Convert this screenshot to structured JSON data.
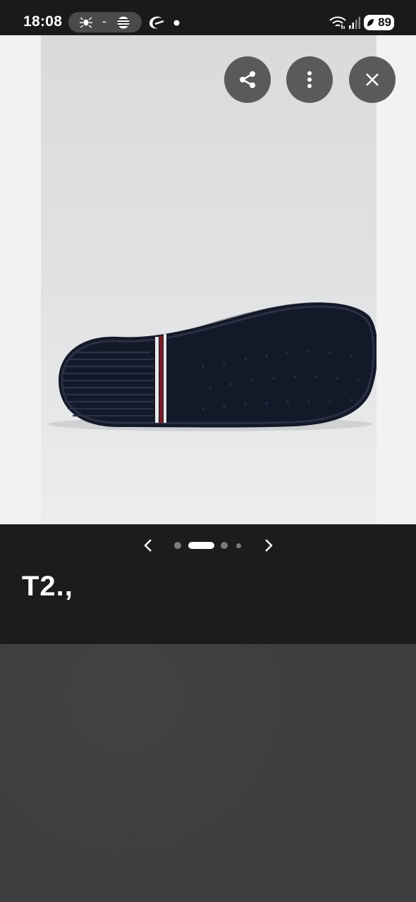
{
  "status_bar": {
    "time": "18:08",
    "battery": "89",
    "icons": [
      "spider-icon",
      "dash",
      "flag-icon",
      "crescent-icon",
      "dot-icon",
      "wifi-icon",
      "signal-icon",
      "battery-icon"
    ]
  },
  "viewer": {
    "buttons": [
      {
        "name": "share-button",
        "icon": "share-icon"
      },
      {
        "name": "more-options-button",
        "icon": "more-vertical-icon"
      },
      {
        "name": "close-button",
        "icon": "close-icon"
      }
    ],
    "image_description": "shoe-sole-photo"
  },
  "carousel": {
    "total_pages": 4,
    "current_page": 2
  },
  "caption": {
    "text": "T2.,"
  },
  "colors": {
    "status_bar_bg": "#1a1a1a",
    "button_bg": "#5a5a5a",
    "page_bg": "#1c1c1c",
    "active_dot": "#ffffff",
    "inactive_dot": "#7a7a7a"
  }
}
